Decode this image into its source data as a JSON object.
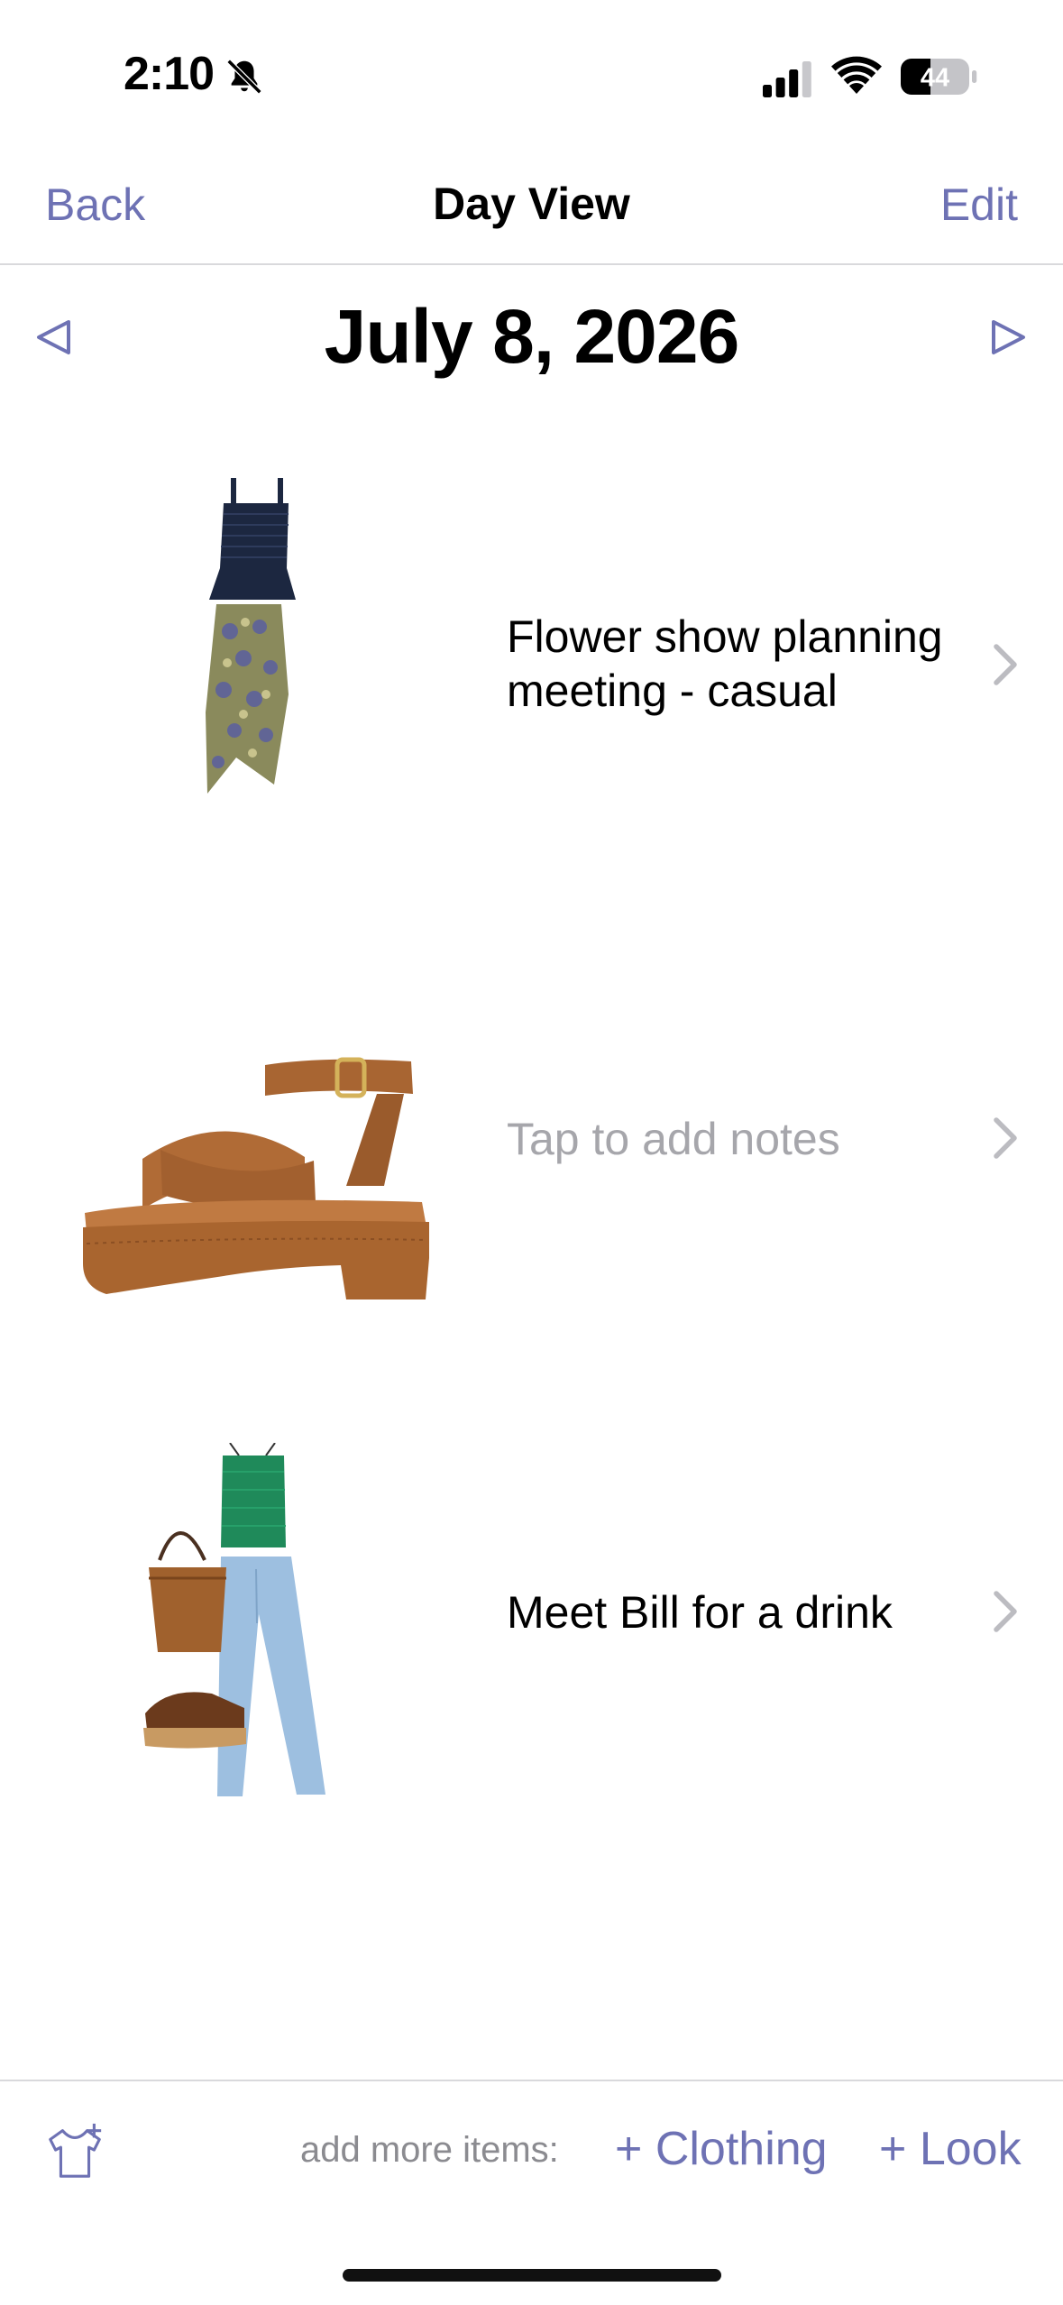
{
  "status_bar": {
    "time": "2:10",
    "battery_level": "44",
    "icons": [
      "bell-slash-icon",
      "cellular-signal-icon",
      "wifi-icon",
      "battery-icon"
    ]
  },
  "nav": {
    "back_label": "Back",
    "title": "Day View",
    "edit_label": "Edit"
  },
  "date_header": {
    "date": "July 8, 2026",
    "prev_icon": "triangle-left-icon",
    "next_icon": "triangle-right-icon"
  },
  "entries": [
    {
      "note": "Flower show planning meeting - casual",
      "image": "outfit-navy-top-printed-skirt"
    },
    {
      "note": "Tap to add notes",
      "image": "tan-platform-sandal"
    },
    {
      "note": "Meet Bill for a drink",
      "image": "outfit-green-top-jeans-bag-clogs"
    }
  ],
  "toolbar": {
    "add_more_label": "add more items:",
    "add_clothing_label": "+ Clothing",
    "add_look_label": "+ Look",
    "wardrobe_icon": "tshirt-plus-icon"
  },
  "colors": {
    "accent": "#6e72b4",
    "placeholder": "#a6a6ab",
    "divider": "#d9d9dc"
  }
}
